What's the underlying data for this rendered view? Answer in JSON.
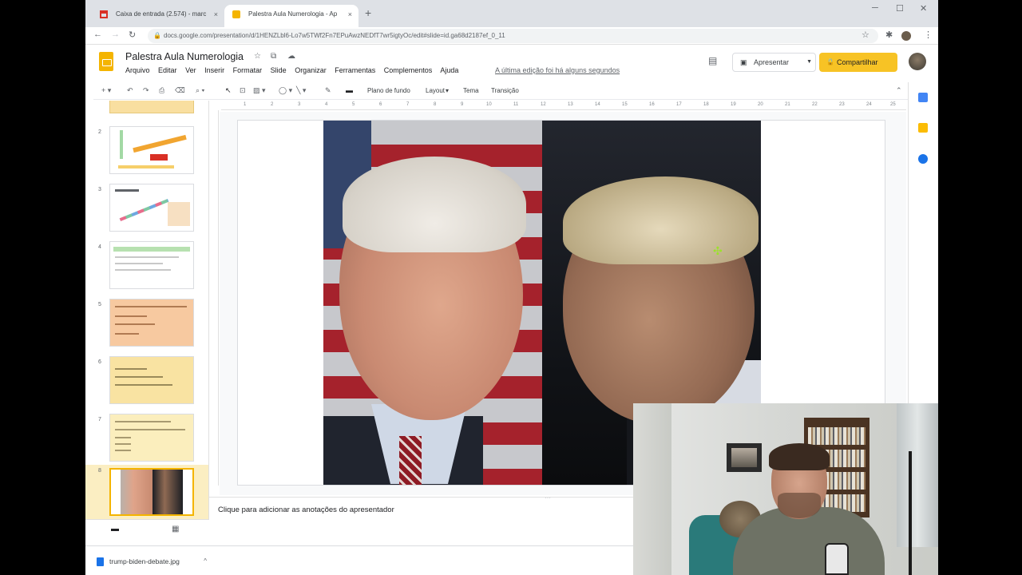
{
  "browser": {
    "tabs": [
      {
        "label": "Caixa de entrada (2.574) - marc",
        "close": "×"
      },
      {
        "label": "Palestra Aula Numerologia - Ap",
        "close": "×"
      }
    ],
    "new_tab": "+",
    "url": "docs.google.com/presentation/d/1HENZLbl6-Lo7w5TWf2Fn7EPuAwzNEDfT7wr5igtyOc/edit#slide=id.ga68d2187ef_0_11"
  },
  "doc": {
    "title": "Palestra Aula Numerologia",
    "menu": [
      "Arquivo",
      "Editar",
      "Ver",
      "Inserir",
      "Formatar",
      "Slide",
      "Organizar",
      "Ferramentas",
      "Complementos",
      "Ajuda"
    ],
    "last_edit": "A última edição foi há alguns segundos",
    "present_label": "Apresentar",
    "share_label": "Compartilhar"
  },
  "edit_toolbar": {
    "background": "Plano de fundo",
    "layout": "Layout",
    "theme": "Tema",
    "transition": "Transição"
  },
  "ruler": {
    "ticks": [
      "1",
      "2",
      "3",
      "4",
      "5",
      "6",
      "7",
      "8",
      "9",
      "10",
      "11",
      "12",
      "13",
      "14",
      "15",
      "16",
      "17",
      "18",
      "19",
      "20",
      "21",
      "22",
      "23",
      "24",
      "25"
    ]
  },
  "filmstrip": {
    "slides": [
      {
        "num": "2"
      },
      {
        "num": "3"
      },
      {
        "num": "4"
      },
      {
        "num": "5"
      },
      {
        "num": "6"
      },
      {
        "num": "7"
      },
      {
        "num": "8"
      }
    ]
  },
  "notes": {
    "placeholder": "Clique para adicionar as anotações do apresentador"
  },
  "download": {
    "filename": "trump-biden-debate.jpg"
  },
  "colors": {
    "slides_yellow": "#f4b400",
    "share_button": "#f7c325",
    "selected_slide_bg": "#fbeec2"
  }
}
